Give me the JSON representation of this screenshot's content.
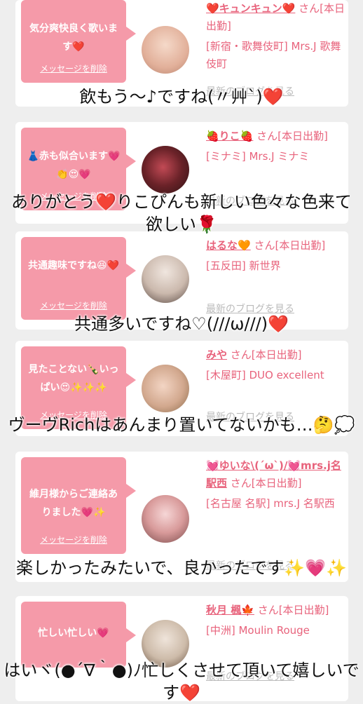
{
  "cards": [
    {
      "message": "気分爽快良く歌います❤️",
      "delete_label": "メッセージを削除",
      "name": "❤️キュンキュン❤️",
      "suffix": "さん[本日出勤]",
      "location": "[新宿・歌舞伎町] Mrs.J 歌舞伎町",
      "blog_link": "最新のブログを見る",
      "caption": "飲もう〜♪ですね(〃艸`)❤️",
      "avatar_color": "#e9c6b5"
    },
    {
      "message": "👗赤も似合います💗👏😍💗",
      "delete_label": "メッセージを削除",
      "name": "🍓りこ🍓",
      "suffix": "さん[本日出勤]",
      "location": "[ミナミ] Mrs.J ミナミ",
      "blog_link": "最新のブログを見る",
      "caption": "ありがとう❤️りこぴんも新しい色々な色来て欲しい🌹",
      "avatar_color": "#7a2a2a"
    },
    {
      "message": "共通趣味ですね😆❤️",
      "delete_label": "メッセージを削除",
      "name": "はるな🧡",
      "suffix": "さん[本日出勤]",
      "location": "[五反田] 新世界",
      "blog_link": "最新のブログを見る",
      "caption": "共通多いですね♡(///ω///)❤️",
      "avatar_color": "#d9cfc8"
    },
    {
      "message": "見たことない🍾いっぱい😍✨✨✨",
      "delete_label": "メッセージを削除",
      "name": "みや",
      "suffix": "さん[本日出勤]",
      "location": "[木屋町] DUO excellent",
      "blog_link": "最新のブログを見る",
      "caption": "ヴーヴRichはあんまり置いてないかも…🤔💭",
      "avatar_color": "#c9a890"
    },
    {
      "message": "維月様からご連絡ありました💗✨",
      "delete_label": "メッセージを削除",
      "name": "💓ゆいな\\(´ω`)/💓mrs.j名駅西",
      "suffix": "さん[本日出勤]",
      "location": "[名古屋 名駅] mrs.J 名駅西",
      "blog_link": "最新のブログを見る",
      "caption": "楽しかったみたいで、良かったです✨💗✨",
      "avatar_color": "#c58a8a"
    },
    {
      "message": "忙しい忙しい💗",
      "delete_label": "メッセージを削除",
      "name": "秋月 楓🍁",
      "suffix": "さん[本日出勤]",
      "location": "[中洲] Moulin Rouge",
      "blog_link": "最新のブログを見る",
      "caption": "はいヾ(●´∇｀●)ﾉ忙しくさせて頂いて嬉しいです❤️",
      "avatar_color": "#d8cfc4"
    }
  ],
  "colors": {
    "bubble": "#f59aa9",
    "name": "#e8637c",
    "background": "#eeeeee"
  }
}
